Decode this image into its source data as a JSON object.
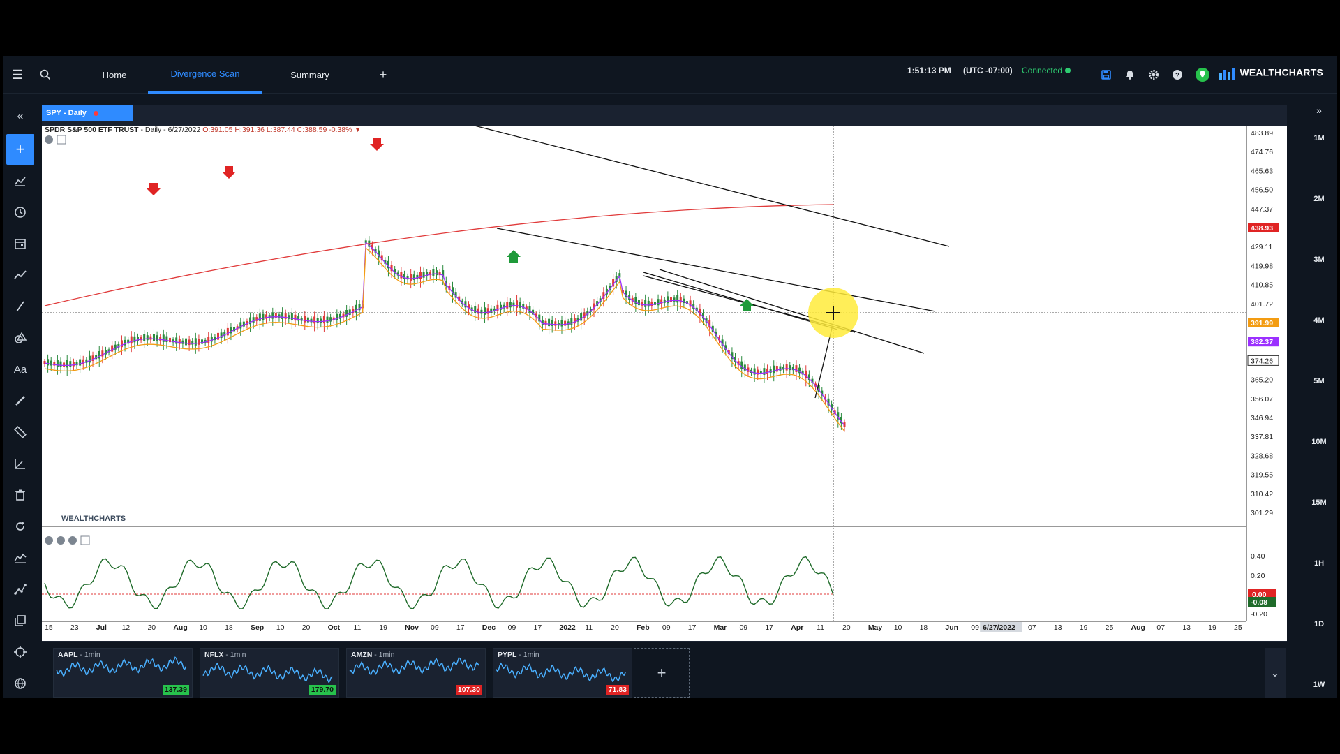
{
  "topbar": {
    "tabs": [
      {
        "label": "Home"
      },
      {
        "label": "Divergence Scan"
      },
      {
        "label": "Summary"
      }
    ],
    "add_tab": "+",
    "time": "1:51:13 PM",
    "timezone": "(UTC -07:00)",
    "status": "Connected",
    "brand": "WEALTHCHARTS"
  },
  "chart": {
    "title": "SPY - Daily",
    "symbol": "SPDR S&P 500 ETF TRUST",
    "interval": " - Daily - 6/27/2022 ",
    "ohlc": "O:391.05 H:391.36 L:387.44 C:388.59 -0.38%",
    "watermark": "WEALTHCHARTS",
    "crosshair_date": "6/27/2022",
    "crosshair_price": "374.26"
  },
  "chart_data": {
    "type": "candlestick",
    "price_axis": [
      "483.89",
      "474.76",
      "465.63",
      "456.50",
      "447.37",
      "438.93",
      "429.11",
      "419.98",
      "410.85",
      "401.72",
      "391.99",
      "382.37",
      "374.26",
      "365.20",
      "356.07",
      "346.94",
      "337.81",
      "328.68",
      "319.55",
      "310.42",
      "301.29"
    ],
    "price_tags": [
      {
        "value": "438.93",
        "color": "#e02424"
      },
      {
        "value": "391.99",
        "color": "#f39c12"
      },
      {
        "value": "382.37",
        "color": "#9b30ff"
      }
    ],
    "oscillator_axis": [
      "0.40",
      "0.20",
      "0.00",
      "-0.08",
      "-0.20"
    ],
    "x_ticks": [
      "15",
      "23",
      "Jul",
      "12",
      "20",
      "Aug",
      "10",
      "18",
      "Sep",
      "10",
      "20",
      "Oct",
      "11",
      "19",
      "Nov",
      "09",
      "17",
      "Dec",
      "09",
      "17",
      "2022",
      "11",
      "20",
      "Feb",
      "09",
      "17",
      "Mar",
      "09",
      "17",
      "Apr",
      "11",
      "20",
      "May",
      "10",
      "18",
      "Jun",
      "09",
      "6/27/2022",
      "07",
      "13",
      "19",
      "25",
      "Aug",
      "07",
      "13",
      "19",
      "25"
    ]
  },
  "left_tools": [
    "collapse",
    "add",
    "indicators",
    "clock",
    "calendar",
    "trend",
    "line",
    "shapes",
    "text",
    "brush",
    "ruler",
    "measure",
    "trash",
    "refresh",
    "chart-type",
    "nodes",
    "layers",
    "target",
    "globe"
  ],
  "timeframes": [
    "1M",
    "2M",
    "3M",
    "4M",
    "5M",
    "10M",
    "15M",
    "1H",
    "1D",
    "1W"
  ],
  "minis": [
    {
      "symbol": "AAPL",
      "interval": " - 1min",
      "price": "137.39",
      "dir": "up"
    },
    {
      "symbol": "NFLX",
      "interval": " - 1min",
      "price": "179.70",
      "dir": "up"
    },
    {
      "symbol": "AMZN",
      "interval": " - 1min",
      "price": "107.30",
      "dir": "down"
    },
    {
      "symbol": "PYPL",
      "interval": " - 1min",
      "price": "71.83",
      "dir": "down"
    }
  ],
  "add_panel": "+"
}
